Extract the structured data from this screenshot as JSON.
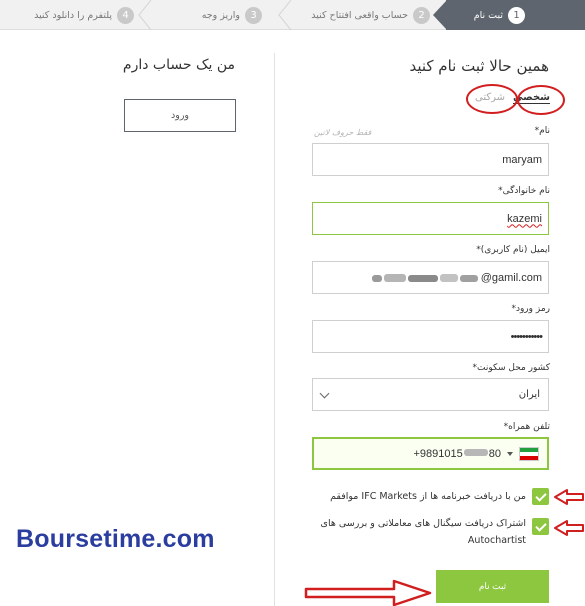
{
  "steps": [
    {
      "number": "1",
      "label": "ثبت نام"
    },
    {
      "number": "2",
      "label": "حساب واقعی افتتاح کنید"
    },
    {
      "number": "3",
      "label": "واریز وجه"
    },
    {
      "number": "4",
      "label": "پلتفرم را دانلود کنید"
    }
  ],
  "register": {
    "title": "همین حالا ثبت نام کنید",
    "tab_personal": "شخصی",
    "tab_corporate": "شرکتی",
    "name_label": "نام*",
    "name_hint": "فقط حروف لاتین",
    "name_value": "maryam",
    "surname_label": "نام خانوادگی*",
    "surname_value": "kazemi",
    "email_label": "ایمیل (نام کاربری)*",
    "email_value": "@gamil.com",
    "password_label": "رمز ورود*",
    "password_value": "•••••••••••",
    "country_label": "کشور محل سکونت*",
    "country_value": "ایران",
    "phone_label": "تلفن همراه*",
    "phone_value": "+9891015",
    "phone_value_end": "80",
    "checkbox1_text": "من با دریافت خبرنامه ها از IFC Markets موافقم",
    "checkbox2_line1": "اشتراک دریافت سیگنال های معاملاتی و بررسی های",
    "checkbox2_line2": "Autochartist",
    "submit_label": "ثبت نام"
  },
  "login": {
    "title": "من یک حساب دارم",
    "button_label": "ورود"
  },
  "watermark": "Boursetime.com",
  "colors": {
    "accent_green": "#8dc63f",
    "step_active": "#5e656e",
    "annotation_red": "#d11f1f",
    "watermark_blue": "#2b3d9e"
  },
  "icons": [
    "chevron-down-icon",
    "iran-flag-icon",
    "checkmark-icon",
    "red-arrow-icon"
  ]
}
